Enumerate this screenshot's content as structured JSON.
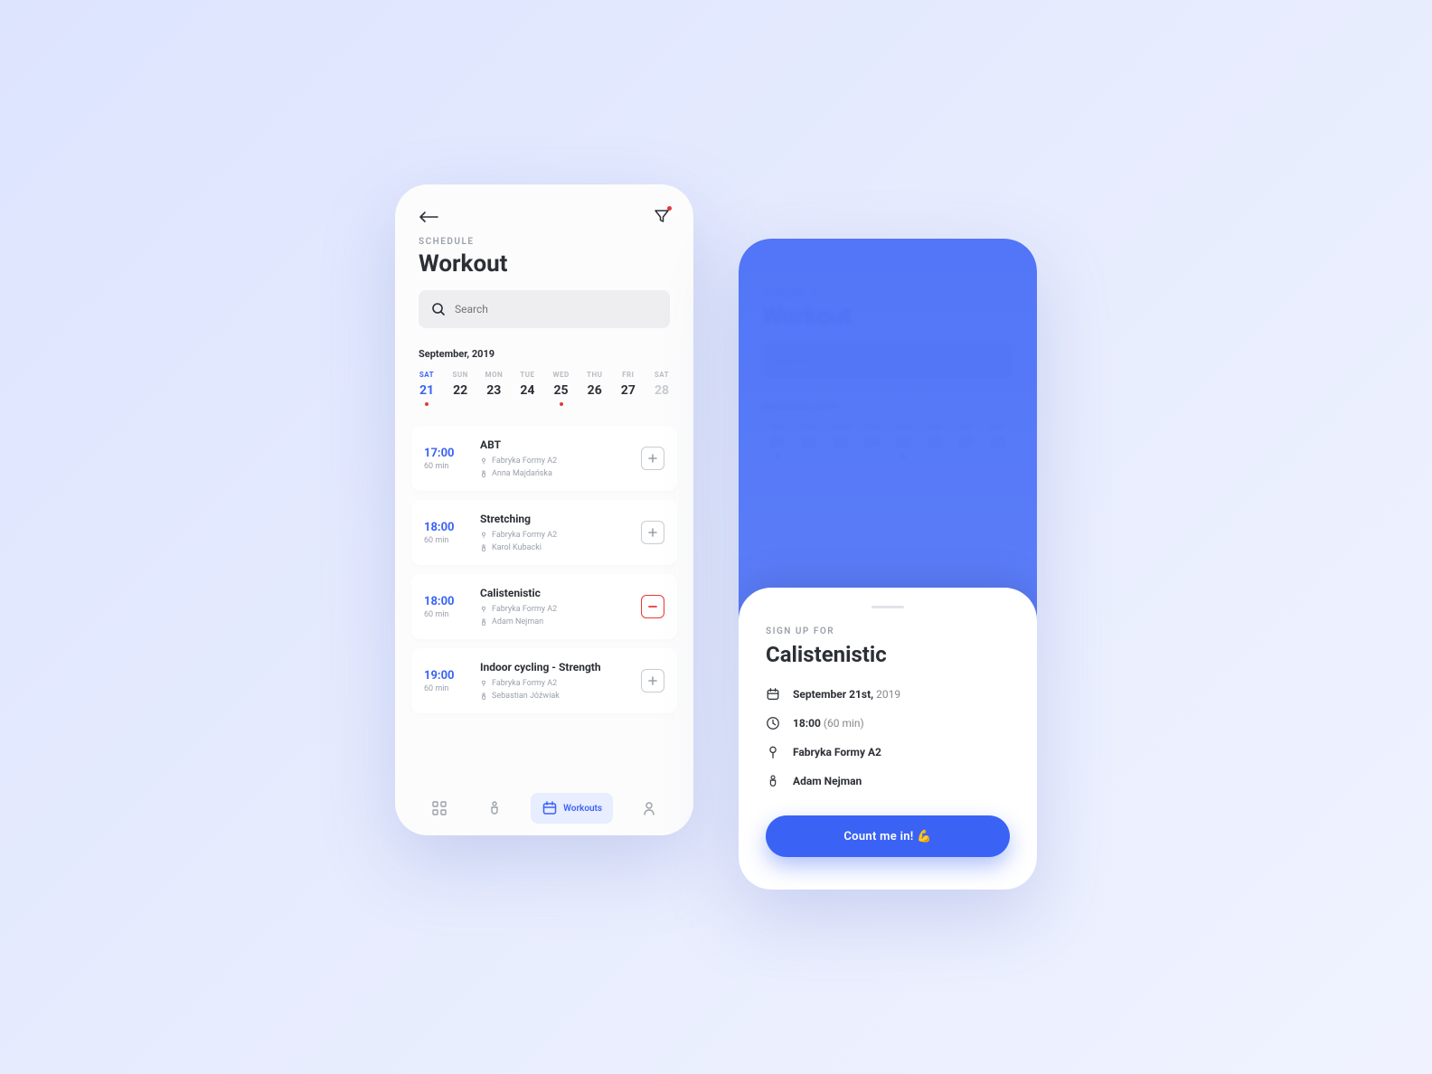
{
  "screen1": {
    "eyebrow": "SCHEDULE",
    "title": "Workout",
    "search_placeholder": "Search",
    "month": "September, 2019",
    "days": [
      {
        "label": "SAT",
        "num": "21",
        "selected": true,
        "dot": true
      },
      {
        "label": "SUN",
        "num": "22"
      },
      {
        "label": "MON",
        "num": "23"
      },
      {
        "label": "TUE",
        "num": "24"
      },
      {
        "label": "WED",
        "num": "25",
        "dot": true
      },
      {
        "label": "THU",
        "num": "26"
      },
      {
        "label": "FRI",
        "num": "27"
      },
      {
        "label": "SAT",
        "num": "28",
        "faded": true
      }
    ],
    "workouts": [
      {
        "time": "17:00",
        "duration": "60 min",
        "title": "ABT",
        "location": "Fabryka Formy A2",
        "trainer": "Anna Majdańska",
        "action": "add"
      },
      {
        "time": "18:00",
        "duration": "60 min",
        "title": "Stretching",
        "location": "Fabryka Formy A2",
        "trainer": "Karol Kubacki",
        "action": "add"
      },
      {
        "time": "18:00",
        "duration": "60 min",
        "title": "Calistenistic",
        "location": "Fabryka Formy A2",
        "trainer": "Adam Nejman",
        "action": "remove"
      },
      {
        "time": "19:00",
        "duration": "60 min",
        "title": "Indoor cycling - Strength",
        "location": "Fabryka Formy A2",
        "trainer": "Sebastian Jóźwiak",
        "action": "add"
      }
    ],
    "tabbar": {
      "active_label": "Workouts"
    }
  },
  "screen2": {
    "eyebrow": "SIGN UP FOR",
    "title": "Calistenistic",
    "date_bold": "September 21st,",
    "date_light": " 2019",
    "time_bold": "18:00",
    "time_light": " (60 min)",
    "location": "Fabryka Formy A2",
    "trainer": "Adam Nejman",
    "cta": "Count me in!  💪"
  }
}
